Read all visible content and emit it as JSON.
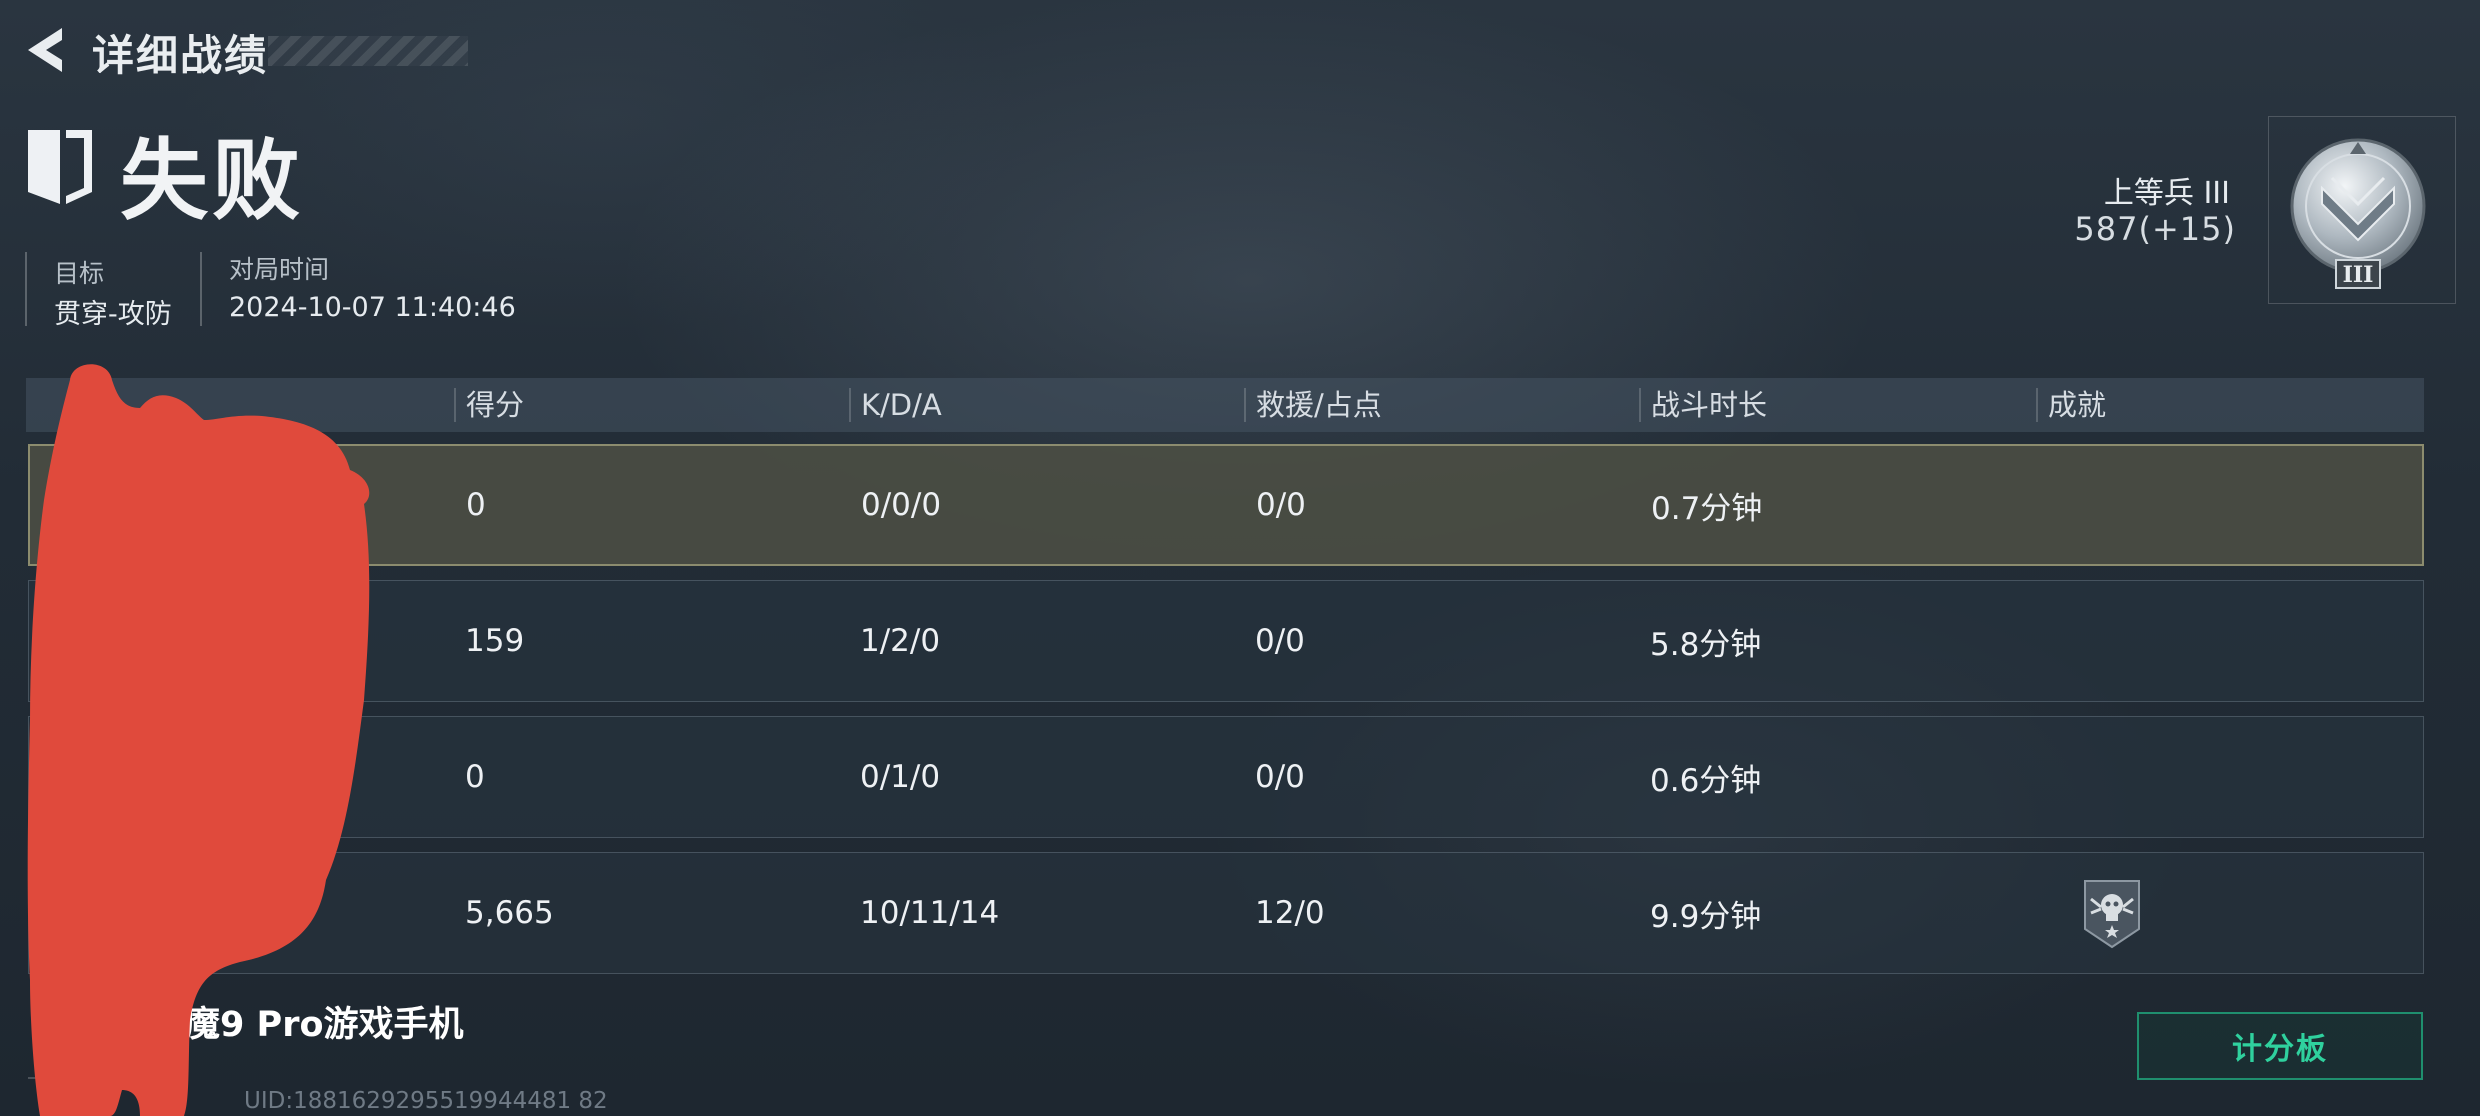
{
  "header": {
    "title": "详细战绩"
  },
  "result": {
    "text": "失败"
  },
  "info": {
    "target_label": "目标",
    "target_value": "贯穿-攻防",
    "time_label": "对局时间",
    "time_value": "2024-10-07 11:40:46"
  },
  "rank": {
    "name": "上等兵 III",
    "score": "587(+15)",
    "badge_numeral": "III"
  },
  "table": {
    "headers": [
      "得分",
      "K/D/A",
      "救援/占点",
      "战斗时长",
      "成就"
    ],
    "rows": [
      {
        "score": "0",
        "kda": "0/0/0",
        "rescue": "0/0",
        "duration": "0.7分钟",
        "highlight": true
      },
      {
        "score": "159",
        "kda": "1/2/0",
        "rescue": "0/0",
        "duration": "5.8分钟"
      },
      {
        "score": "0",
        "kda": "0/1/0",
        "rescue": "0/0",
        "duration": "0.6分钟"
      },
      {
        "score": "5,665",
        "kda": "10/11/14",
        "rescue": "12/0",
        "duration": "9.9分钟",
        "achievement_icon": "skull-emblem-icon"
      }
    ]
  },
  "footer": {
    "device": "魔9 Pro游戏手机",
    "uid": "UID:1881629295519944481 82",
    "scoreboard_button": "计分板"
  },
  "colors": {
    "accent": "#2fd19e",
    "highlight_row": "#4e5044",
    "redaction": "#e04a3c"
  }
}
